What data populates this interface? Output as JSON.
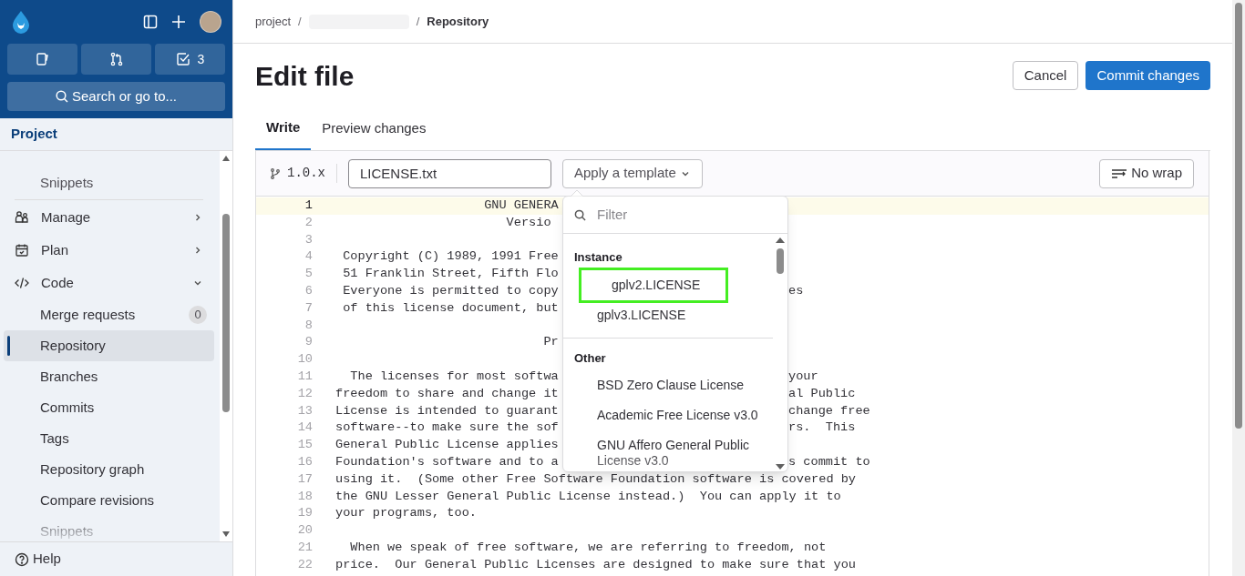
{
  "header": {
    "todo_count": "3",
    "search_placeholder": "Search or go to..."
  },
  "sidebar": {
    "title": "Project",
    "items": [
      {
        "label": "Snippets",
        "kind": "link"
      },
      {
        "label": "Manage",
        "kind": "section",
        "expanded": false
      },
      {
        "label": "Plan",
        "kind": "section",
        "expanded": false
      },
      {
        "label": "Code",
        "kind": "section",
        "expanded": true,
        "children": [
          {
            "label": "Merge requests",
            "count": "0",
            "selected": false
          },
          {
            "label": "Repository",
            "selected": true
          },
          {
            "label": "Branches",
            "selected": false
          },
          {
            "label": "Commits",
            "selected": false
          },
          {
            "label": "Tags",
            "selected": false
          },
          {
            "label": "Repository graph",
            "selected": false
          },
          {
            "label": "Compare revisions",
            "selected": false
          },
          {
            "label": "Snippets",
            "selected": false
          }
        ]
      }
    ],
    "help": "Help"
  },
  "breadcrumb": {
    "first": "project",
    "separators": [
      "/",
      "/"
    ],
    "last": "Repository"
  },
  "title": "Edit file",
  "actions": {
    "cancel": "Cancel",
    "commit": "Commit changes"
  },
  "tabs": [
    {
      "label": "Write",
      "selected": true
    },
    {
      "label": "Preview changes",
      "selected": false
    }
  ],
  "editor": {
    "branch": "1.0.x",
    "filename": "LICENSE.txt",
    "template_button": "Apply a template",
    "wrap_button": "No wrap",
    "lines": [
      {
        "number": "1",
        "text": "                    GNU GENERA",
        "current": true
      },
      {
        "number": "2",
        "text": "                       Versio",
        "current": false
      },
      {
        "number": "3",
        "current": false
      },
      {
        "number": "4",
        "text": " Copyright (C) 1989, 1991 Free",
        "current": false
      },
      {
        "number": "5",
        "text": " 51 Franklin Street, Fifth Flo",
        "current": false
      },
      {
        "number": "6",
        "text": " Everyone is permitted to copy",
        "right": "es",
        "current": false
      },
      {
        "number": "7",
        "text": " of this license document, but",
        "current": false
      },
      {
        "number": "8",
        "current": false
      },
      {
        "number": "9",
        "text": "                            Pr",
        "current": false
      },
      {
        "number": "10",
        "current": false
      },
      {
        "number": "11",
        "text": "  The licenses for most softwa",
        "right": "your",
        "current": false
      },
      {
        "number": "12",
        "text": "freedom to share and change it",
        "right": "al Public",
        "current": false
      },
      {
        "number": "13",
        "text": "License is intended to guarant",
        "right": "change free",
        "current": false
      },
      {
        "number": "14",
        "text": "software--to make sure the sof",
        "right": "rs.  This",
        "current": false
      },
      {
        "number": "15",
        "text": "General Public License applies",
        "current": false
      },
      {
        "number": "16",
        "text": "Foundation's software and to a",
        "right": "s commit to",
        "current": false
      },
      {
        "number": "17",
        "text": "using it.  (Some other Free Software Foundation software is covered by",
        "current": false
      },
      {
        "number": "18",
        "text": "the GNU Lesser General Public License instead.)  You can apply it to",
        "current": false
      },
      {
        "number": "19",
        "text": "your programs, too.",
        "current": false
      },
      {
        "number": "20",
        "current": false
      },
      {
        "number": "21",
        "text": "  When we speak of free software, we are referring to freedom, not",
        "current": false
      },
      {
        "number": "22",
        "text": "price.  Our General Public Licenses are designed to make sure that you",
        "current": false
      }
    ]
  },
  "template_menu": {
    "placeholder": "Filter",
    "groups": [
      {
        "title": "Instance",
        "items": [
          {
            "label": "gplv2.LICENSE",
            "highlighted": true
          },
          {
            "label": "gplv3.LICENSE",
            "highlighted": false
          }
        ]
      },
      {
        "title": "Other",
        "items": [
          {
            "label": "BSD Zero Clause License",
            "highlighted": false
          },
          {
            "label": "Academic Free License v3.0",
            "highlighted": false
          },
          {
            "label": "GNU Affero General Public License v3.0",
            "highlighted": false
          }
        ]
      }
    ]
  }
}
